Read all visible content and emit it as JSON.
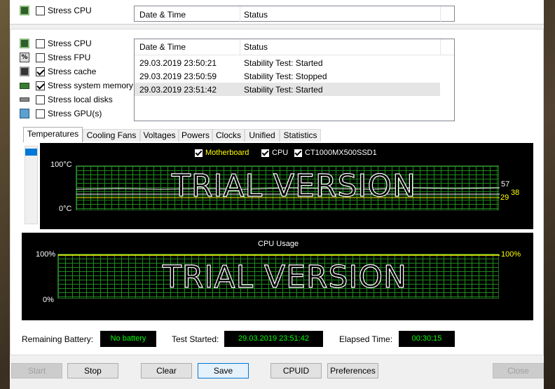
{
  "top_partial": {
    "stress_cpu_label": "Stress CPU",
    "col_date": "Date & Time",
    "col_status": "Status"
  },
  "options": [
    {
      "label": "Stress CPU",
      "checked": false,
      "icon": "cpu-icon"
    },
    {
      "label": "Stress FPU",
      "checked": false,
      "icon": "fpu-icon"
    },
    {
      "label": "Stress cache",
      "checked": true,
      "icon": "cache-icon"
    },
    {
      "label": "Stress system memory",
      "checked": true,
      "icon": "memory-icon"
    },
    {
      "label": "Stress local disks",
      "checked": false,
      "icon": "disk-icon"
    },
    {
      "label": "Stress GPU(s)",
      "checked": false,
      "icon": "gpu-icon"
    }
  ],
  "log": {
    "col_date": "Date & Time",
    "col_status": "Status",
    "rows": [
      {
        "date": "29.03.2019 23:50:21",
        "status": "Stability Test: Started"
      },
      {
        "date": "29.03.2019 23:50:59",
        "status": "Stability Test: Stopped"
      },
      {
        "date": "29.03.2019 23:51:42",
        "status": "Stability Test: Started"
      }
    ]
  },
  "tabs": [
    "Temperatures",
    "Cooling Fans",
    "Voltages",
    "Powers",
    "Clocks",
    "Unified",
    "Statistics"
  ],
  "temp_graph": {
    "legend": [
      "Motherboard",
      "CPU",
      "CT1000MX500SSD1"
    ],
    "legend_colors": [
      "#ffff00",
      "#ffffff",
      "#ffffff"
    ],
    "y_top": "100°C",
    "y_bottom": "0°C",
    "val_cpu": "57",
    "val_mb": "29",
    "val_ssd": "38",
    "watermark": "TRIAL VERSION"
  },
  "cpu_graph": {
    "title": "CPU Usage",
    "y_top": "100%",
    "y_bottom": "0%",
    "value": "100%",
    "watermark": "TRIAL VERSION"
  },
  "status": {
    "battery_label": "Remaining Battery:",
    "battery_value": "No battery",
    "started_label": "Test Started:",
    "started_value": "29.03.2019 23:51:42",
    "elapsed_label": "Elapsed Time:",
    "elapsed_value": "00:30:15"
  },
  "buttons": {
    "start": "Start",
    "stop": "Stop",
    "clear": "Clear",
    "save": "Save",
    "cpuid": "CPUID",
    "preferences": "Preferences",
    "close": "Close"
  },
  "colors": {
    "graph_green": "#00ff00",
    "motherboard": "#ffff00",
    "accent": "#0078d7"
  }
}
